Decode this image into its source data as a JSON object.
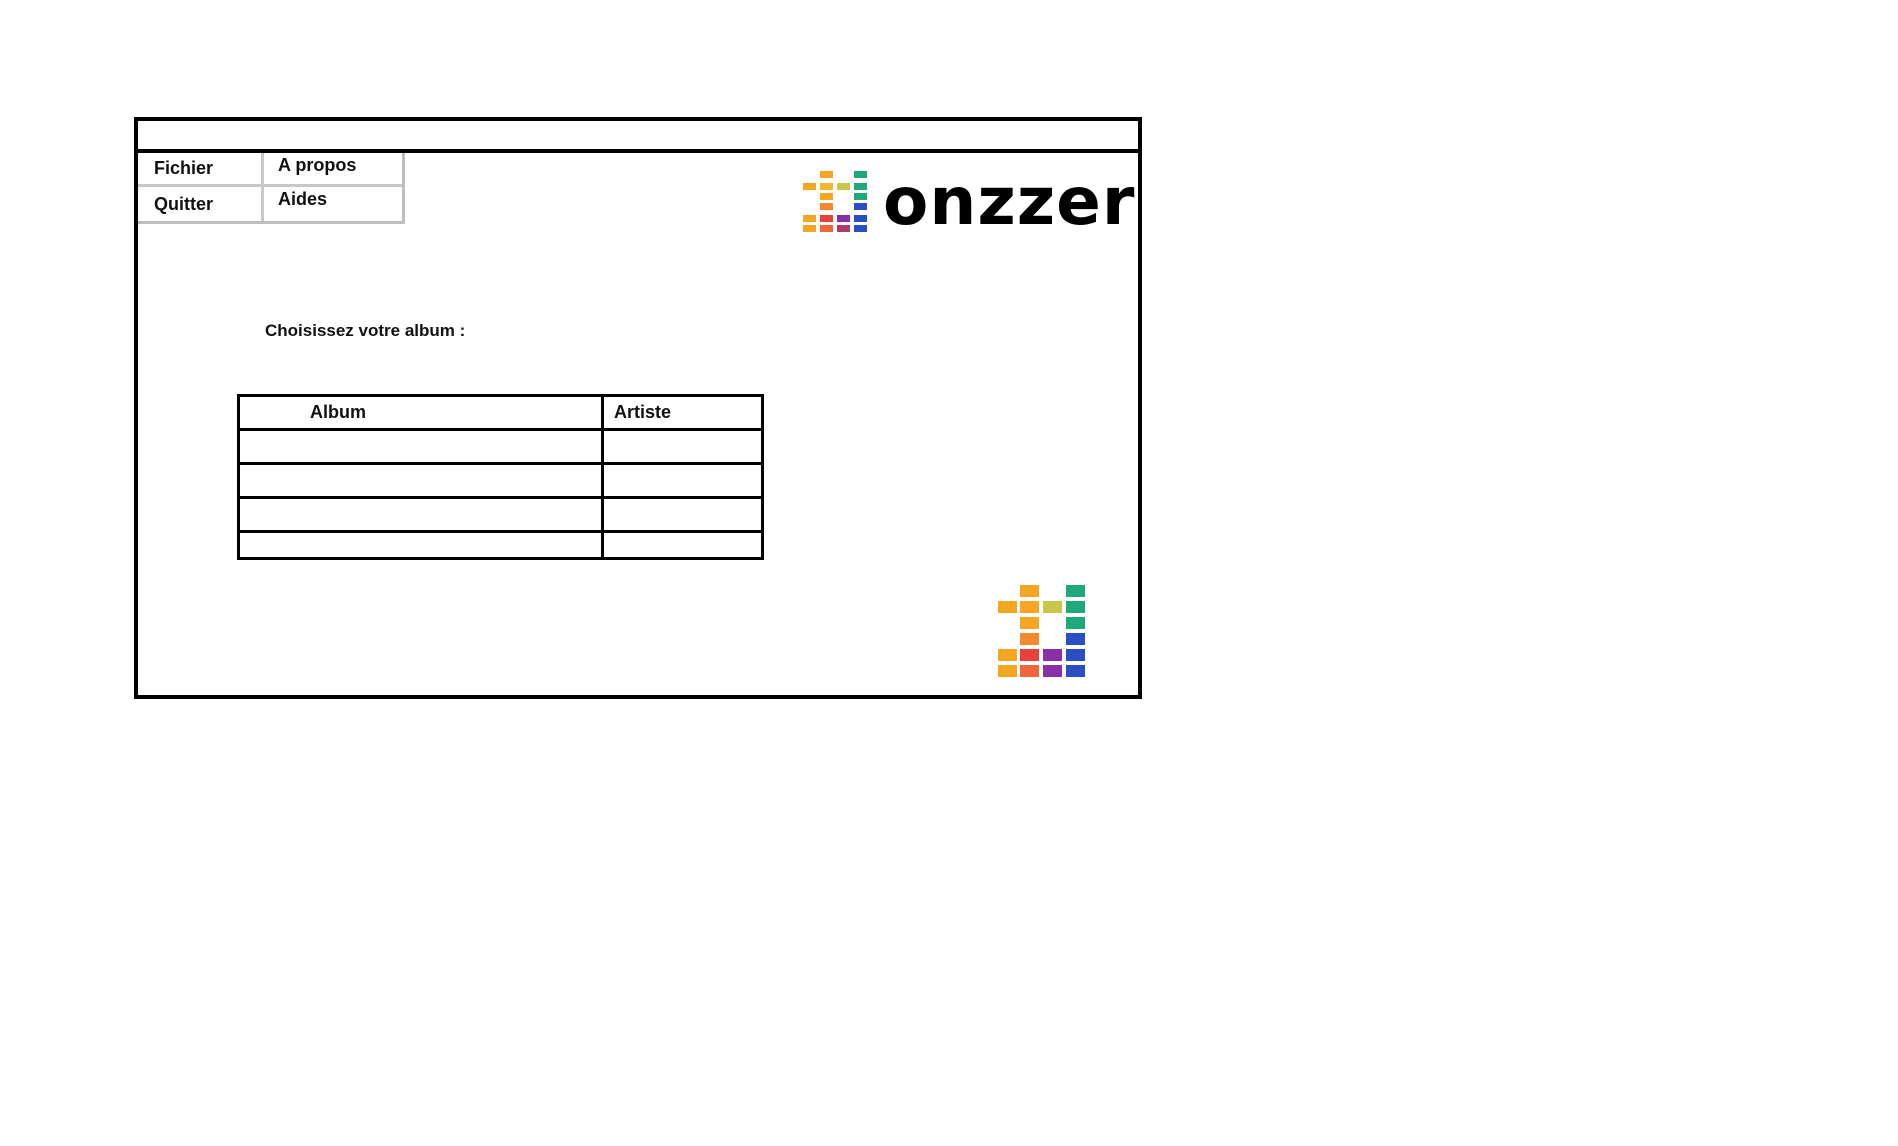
{
  "menu": {
    "items": [
      {
        "label": "Fichier"
      },
      {
        "label": "A propos"
      },
      {
        "label": "Quitter"
      },
      {
        "label": "Aides"
      }
    ]
  },
  "logo": {
    "text": "onzzer",
    "icon": "equalizer-bars-icon"
  },
  "prompt": "Choisissez votre album :",
  "table": {
    "columns": [
      "Album",
      "Artiste"
    ],
    "rows": [
      [
        "",
        ""
      ],
      [
        "",
        ""
      ],
      [
        "",
        ""
      ],
      [
        "",
        ""
      ]
    ]
  },
  "colors": {
    "orange": "#f5a623",
    "red": "#e8413c",
    "purple": "#8b2fa8",
    "green": "#1fa97a",
    "blue": "#2a4fc2"
  }
}
